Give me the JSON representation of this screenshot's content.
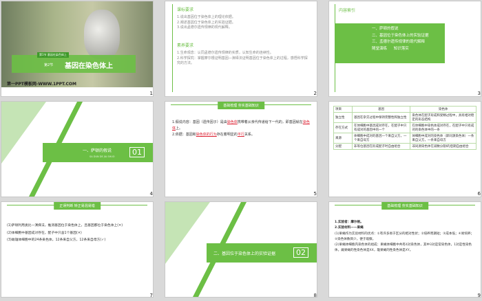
{
  "slides": [
    {
      "num": "1",
      "badge": "第1节 基因在染色体上",
      "section": "第2节",
      "title": "基因在染色体上",
      "footer": "第一PPT模板网-WWW.1PPT.COM"
    },
    {
      "num": "2",
      "h1": "课标要求",
      "l1": [
        "1.说出基因位于染色体上的理论依据。",
        "2.阐述基因位于染色体上的实验证据。",
        "3.说出孟德尔遗传规律的现代解释。"
      ],
      "h2": "素养要求",
      "l2": [
        "1.生命观念：认同孟德尔遗传规律的实质，认知生命的连续性。",
        "2.科学探究：掌握摩尔根证明基因—演绎法证明基因位于染色体上的过程，感悟科学探究的方法。"
      ]
    },
    {
      "num": "3",
      "h": "内容索引",
      "items": [
        "一、萨顿的假说",
        "二、基因位于染色体上的实验证据",
        "三、孟德尔遗传规律的现代解释",
        "随堂演练",
        "知识落实"
      ]
    },
    {
      "num": "4",
      "label": "一、萨顿的假说",
      "sub": "SA DUN DE JIA SHUO",
      "idx": "01"
    },
    {
      "num": "5",
      "badge": "基础梳理  夯实基础知识",
      "p1a": "1.假说内容：基因（遗传因子）是由",
      "p1b": "染色体",
      "p1c": "携带着从亲代传递给下一代的，即基因就在",
      "p1d": "染色体",
      "p1e": "上。",
      "p2a": "2.依据：基因和",
      "p2b": "染色体的行为",
      "p2c": "存在着明显的",
      "p2d": "平行",
      "p2e": "关系。"
    },
    {
      "num": "6",
      "head": [
        "项目",
        "基因",
        "染色体"
      ],
      "rows": [
        [
          "独立性",
          "基因在杂交过程中保持完整性和独立性",
          "染色体在配子形成和受精过程中，具有相对稳定的形态结构"
        ],
        [
          "存在方式",
          "在体细胞中基因成对存在，在配子中只有成对的基因中的一个",
          "在体细胞中染色体成对存在，在配子中只有成对的染色体中的一条"
        ],
        [
          "来源",
          "体细胞中成对的基因一个来自父方，一个来自母方",
          "体细胞中成对的染色体（即同源染色体）一条来自父方，一条来自母方"
        ],
        [
          "分配",
          "非等位基因在形成配子时自由组合",
          "非同源染色体在减数分裂Ⅰ的后期自由组合"
        ]
      ]
    },
    {
      "num": "7",
      "badge": "正误判断  矫正易混易错",
      "l": [
        "(1)萨顿利用类比—演绎法，推测基因位于染色体上，且基因都位于染色体上(✕)",
        "(2)体细胞中基因成对存在，配子中只含1个基因(✕)",
        "(3)雌雄体细胞中的24条染色体，12条来自父方，12条来自母方(✓)"
      ]
    },
    {
      "num": "8",
      "label": "二、基因位于染色体上的实验证据",
      "idx": "02"
    },
    {
      "num": "9",
      "badge": "基础梳理  夯实基础知识",
      "l": [
        "1.实验者：摩尔根。",
        "2.实验材料——果蝇",
        "(1)果蝇作为实验材料的优点：①有许多易于区分的相对性状；②培养周期短；③成本低；④易饲养；⑤染色体数目少，便于观察。",
        "(2)果蝇体细胞内染色体的组成：果蝇体细胞中共有4对染色体，其中3对是常染色体，1对是性染色体。雌果蝇的性染色体是XX，雄果蝇的性染色体是XY。"
      ]
    }
  ],
  "colors": {
    "accent": "#6cbf45",
    "frame": "#d9d9d9"
  }
}
